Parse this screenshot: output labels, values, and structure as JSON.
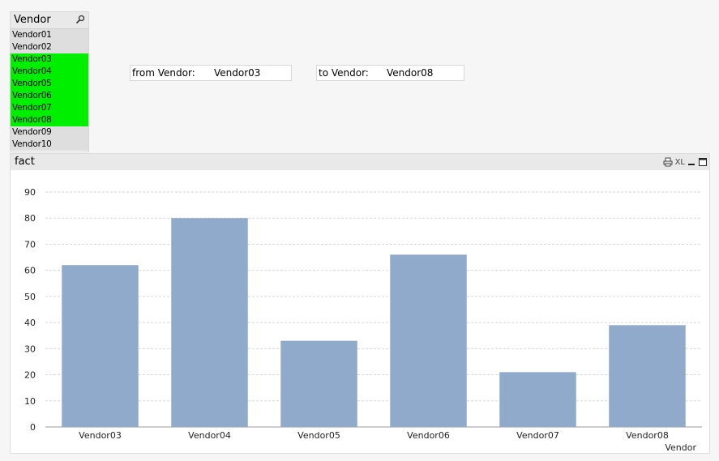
{
  "listbox": {
    "title": "Vendor",
    "items": [
      {
        "label": "Vendor01",
        "selected": false
      },
      {
        "label": "Vendor02",
        "selected": false
      },
      {
        "label": "Vendor03",
        "selected": true
      },
      {
        "label": "Vendor04",
        "selected": true
      },
      {
        "label": "Vendor05",
        "selected": true
      },
      {
        "label": "Vendor06",
        "selected": true
      },
      {
        "label": "Vendor07",
        "selected": true
      },
      {
        "label": "Vendor08",
        "selected": true
      },
      {
        "label": "Vendor09",
        "selected": false
      },
      {
        "label": "Vendor10",
        "selected": false
      }
    ],
    "selected_color": "#00ee00",
    "search_icon": "search-icon"
  },
  "from_box": {
    "label": "from Vendor:",
    "value": "Vendor03"
  },
  "to_box": {
    "label": "to Vendor:",
    "value": "Vendor08"
  },
  "chart_panel": {
    "title": "fact",
    "icons": {
      "print": "print-icon",
      "xl": "XL",
      "minimize": "minimize-icon",
      "maximize": "maximize-icon"
    }
  },
  "chart_data": {
    "type": "bar",
    "categories": [
      "Vendor03",
      "Vendor04",
      "Vendor05",
      "Vendor06",
      "Vendor07",
      "Vendor08"
    ],
    "values": [
      62,
      80,
      33,
      66,
      21,
      39
    ],
    "xlabel": "Vendor",
    "ylabel": "",
    "ylim": [
      0,
      90
    ],
    "yticks": [
      0,
      10,
      20,
      30,
      40,
      50,
      60,
      70,
      80,
      90
    ],
    "grid": true,
    "bar_color": "#8faacb"
  }
}
